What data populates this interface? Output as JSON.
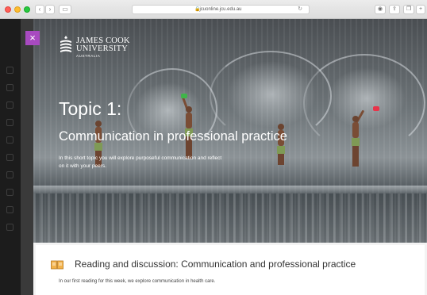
{
  "browser": {
    "url": "jcuonline.jcu.edu.au",
    "lock_glyph": "🔒",
    "reload_glyph": "↻",
    "back_glyph": "‹",
    "forward_glyph": "›",
    "sidebar_toggle_glyph": "▭",
    "toolbar_icons": [
      "privacy-icon",
      "share-icon",
      "tabs-icon",
      "new-tab-icon"
    ],
    "toolbar_glyphs": [
      "◉",
      "⇪",
      "❐",
      "+"
    ]
  },
  "overlay": {
    "close_glyph": "×",
    "accent_color": "#a84ac0"
  },
  "logo": {
    "line1": "JAMES COOK",
    "line2": "UNIVERSITY",
    "line3": "AUSTRALIA"
  },
  "hero": {
    "title": "Topic 1:",
    "subtitle": "Communication in professional practice",
    "description": "In this short topic you will explore purposeful communication and reflect on it with your peers."
  },
  "section": {
    "icon": "book-icon",
    "title": "Reading and discussion: Communication and professional practice",
    "body": "In our first reading for this week, we explore communication in health care."
  }
}
